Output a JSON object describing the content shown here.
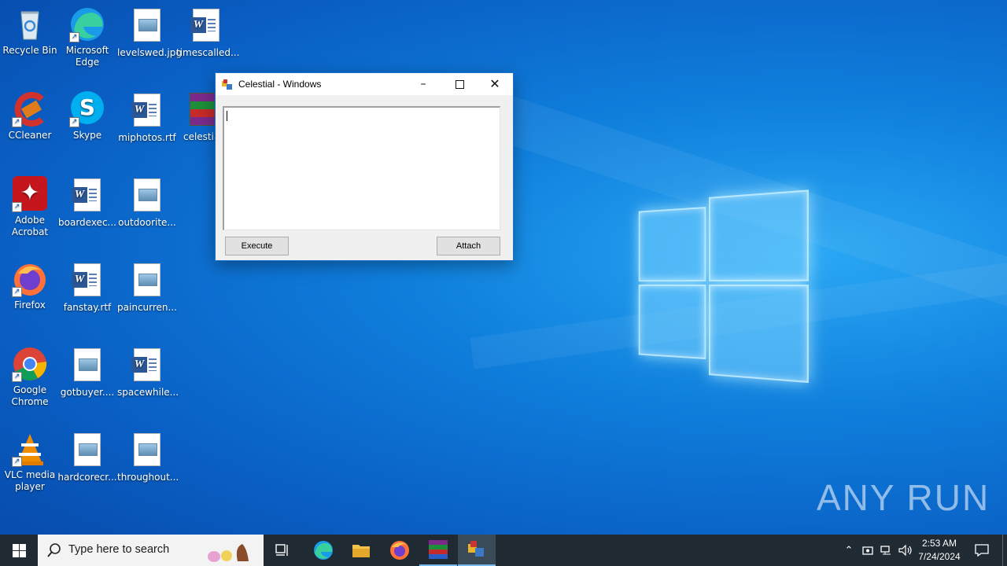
{
  "desktop": {
    "icons": [
      {
        "label": "Recycle Bin",
        "icon": "recycle-bin-icon"
      },
      {
        "label": "Microsoft Edge",
        "icon": "edge-icon"
      },
      {
        "label": "levelswed.jpg",
        "icon": "image-file-icon"
      },
      {
        "label": "timescalled...",
        "icon": "word-doc-icon"
      },
      {
        "label": "CCleaner",
        "icon": "ccleaner-icon"
      },
      {
        "label": "Skype",
        "icon": "skype-icon"
      },
      {
        "label": "miphotos.rtf",
        "icon": "word-doc-icon"
      },
      {
        "label": "celestial-",
        "icon": "winrar-icon"
      },
      {
        "label": "Adobe Acrobat",
        "icon": "acrobat-icon"
      },
      {
        "label": "boardexec...",
        "icon": "word-doc-icon"
      },
      {
        "label": "outdoorite...",
        "icon": "image-file-icon"
      },
      {
        "label": "Firefox",
        "icon": "firefox-icon"
      },
      {
        "label": "fanstay.rtf",
        "icon": "word-doc-icon"
      },
      {
        "label": "paincurren...",
        "icon": "image-file-icon"
      },
      {
        "label": "Google Chrome",
        "icon": "chrome-icon"
      },
      {
        "label": "gotbuyer....",
        "icon": "image-file-icon"
      },
      {
        "label": "spacewhile...",
        "icon": "word-doc-icon"
      },
      {
        "label": "VLC media player",
        "icon": "vlc-icon"
      },
      {
        "label": "hardcorecr...",
        "icon": "image-file-icon"
      },
      {
        "label": "throughout...",
        "icon": "image-file-icon"
      }
    ]
  },
  "window": {
    "title": "Celestial - Windows",
    "editor_text": "",
    "execute_label": "Execute",
    "attach_label": "Attach"
  },
  "taskbar": {
    "search_placeholder": "Type here to search",
    "time": "2:53 AM",
    "date": "7/24/2024"
  },
  "watermark": "ANY RUN"
}
